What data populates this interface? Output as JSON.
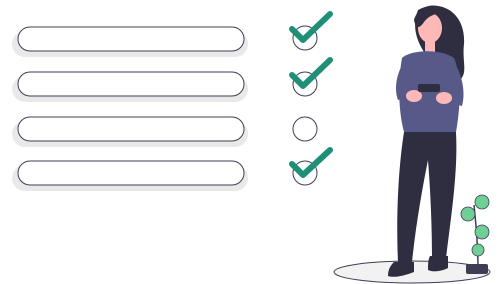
{
  "checklist": {
    "items": [
      {
        "checked": true
      },
      {
        "checked": true
      },
      {
        "checked": false
      },
      {
        "checked": true
      }
    ]
  },
  "colors": {
    "accent_green": "#1f8f78",
    "bar_fill": "#ffffff",
    "bar_shadow": "#e9e9e9",
    "bar_outline": "#3f3d56",
    "shirt": "#575a89",
    "pants": "#2f2e41",
    "hair": "#2f2e41",
    "skin": "#ffb8b8",
    "plant_leaf": "#6fcf97",
    "ground": "#f2f2f2"
  },
  "icons": {
    "checkmark": "checkmark-icon",
    "circle": "circle-icon",
    "plant": "plant-icon"
  }
}
